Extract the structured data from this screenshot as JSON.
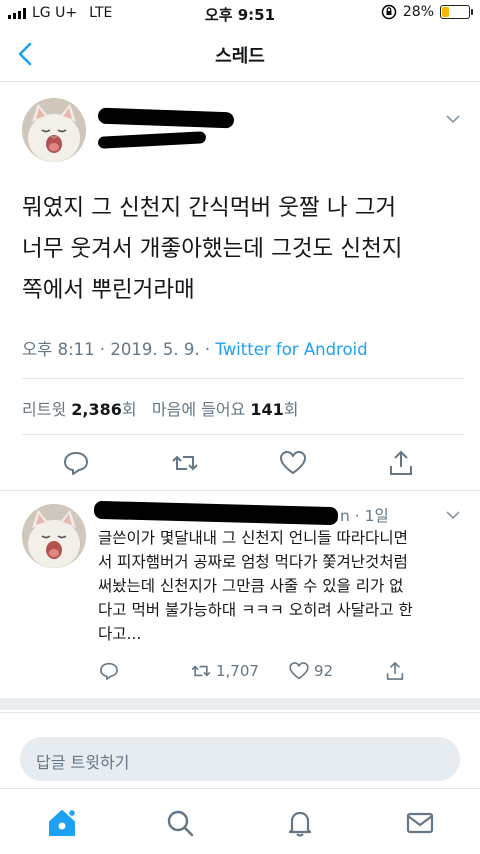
{
  "status": {
    "carrier": "LG U+",
    "network": "LTE",
    "time": "오후 9:51",
    "battery_text": "28%",
    "battery_level": 0.28
  },
  "nav": {
    "title": "스레드"
  },
  "tweet": {
    "text": "뭐였지 그 신천지 간식먹버 웃짤 나 그거\n너무 웃겨서 개좋아했는데 그것도 신천지\n쪽에서 뿌린거라매",
    "time": "오후 8:11 · 2019. 5. 9. · ",
    "via": "Twitter for Android",
    "retweets_label": "리트윗",
    "retweets_count": "2,386",
    "retweets_unit": "회",
    "likes_label": "마음에 들어요",
    "likes_count": "141",
    "likes_unit": "회"
  },
  "reply": {
    "time_suffix": "n · 1일",
    "text": "글쓴이가 몇달내내 그 신천지 언니들 따라다니면\n서 피자햄버거 공짜로 엄청 먹다가 쫓겨난것처럼\n써놨는데 신천지가 그만큼 사줄 수 있을 리가 없\n다고 먹버 불가능하대 ㅋㅋㅋ 오히려 사달라고 한\n다고...",
    "retweets": "1,707",
    "likes": "92"
  },
  "compose": {
    "placeholder": "답글 트윗하기"
  },
  "colors": {
    "accent": "#1da1f2",
    "muted": "#657786",
    "battery": "#f5b800"
  }
}
